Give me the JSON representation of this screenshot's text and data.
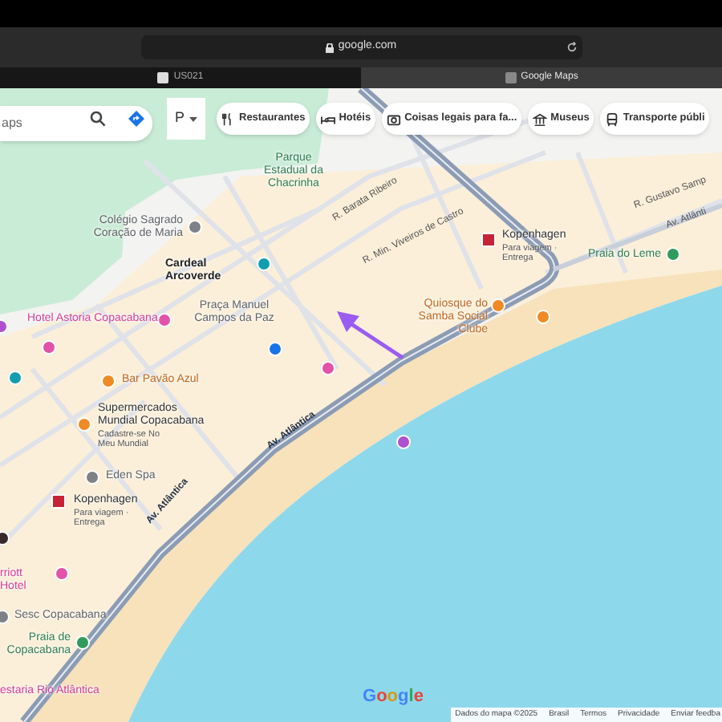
{
  "browser": {
    "address": "google.com",
    "tabs": [
      {
        "label": "US021",
        "selected": false
      },
      {
        "label": "Google Maps",
        "selected": true
      }
    ]
  },
  "search": {
    "placeholder": "aps"
  },
  "layer_button": {
    "label": "P"
  },
  "chips": [
    {
      "label": "Restaurantes",
      "kind": "food"
    },
    {
      "label": "Hotéis",
      "kind": "hotel"
    },
    {
      "label": "Coisas legais para fa...",
      "kind": "camera"
    },
    {
      "label": "Museus",
      "kind": "museum"
    },
    {
      "label": "Transporte públi",
      "kind": "transit"
    }
  ],
  "places": [
    {
      "name": "Parque Estadual da Chacrinha",
      "kind": "park"
    },
    {
      "name": "Colégio Sagrado Coração de Maria",
      "kind": "school"
    },
    {
      "name": "Cardeal Arcoverde",
      "kind": "metro"
    },
    {
      "name": "Hotel Astoria Copacabana",
      "kind": "hotel"
    },
    {
      "name": "Praça Manuel Campos da Paz",
      "kind": "square"
    },
    {
      "name": "Bar Pavão Azul",
      "kind": "bar"
    },
    {
      "name": "Supermercados Mundial Copacabana",
      "subtitle": "Cadastre-se No Meu Mundial",
      "kind": "store"
    },
    {
      "name": "Eden Spa",
      "kind": "spa"
    },
    {
      "name": "Kopenhagen",
      "subtitle": "Para viagem · Entrega",
      "kind": "chocolate"
    },
    {
      "name": "Kopenhagen",
      "subtitle": "Para viagem · Entrega",
      "kind": "chocolate"
    },
    {
      "name": "Quiosque do Samba Social Clube",
      "kind": "bar"
    },
    {
      "name": "Praia do Leme",
      "kind": "beach"
    },
    {
      "name": "rriott Hotel",
      "kind": "hotel"
    },
    {
      "name": "Sesc Copacabana",
      "kind": "venue"
    },
    {
      "name": "Praia de Copacabana",
      "kind": "beach"
    },
    {
      "name": "estaria Rio Atlântica",
      "kind": "hotel"
    }
  ],
  "streets": [
    "R. Barata Ribeiro",
    "R. Min. Viveiros de Castro",
    "R. Gustavo Samp",
    "Av. Atlânti",
    "Av. Atlântica",
    "Av. Atlântica"
  ],
  "logo": "Google",
  "footer": [
    "Dados do mapa ©2025",
    "Brasil",
    "Termos",
    "Privacidade",
    "Enviar feedba"
  ]
}
